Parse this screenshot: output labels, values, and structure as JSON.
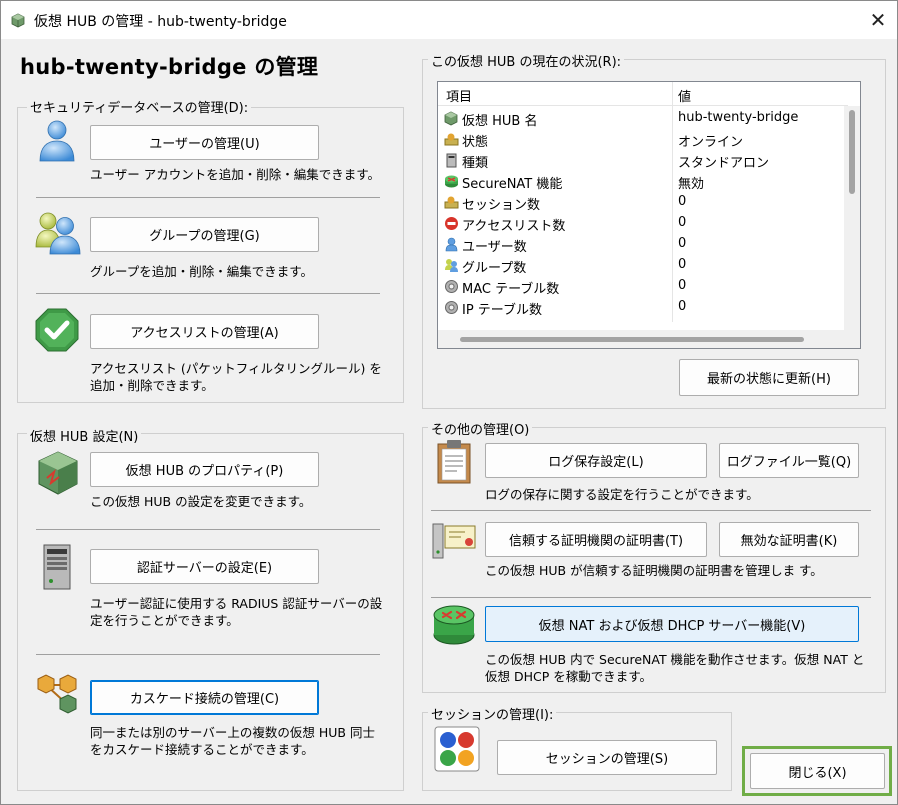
{
  "window": {
    "title": "仮想 HUB の管理 - hub-twenty-bridge",
    "close_glyph": "✕"
  },
  "heading": "hub-twenty-bridge の管理",
  "security": {
    "label": "セキュリティデータベースの管理(D):",
    "user_button": "ユーザーの管理(U)",
    "user_desc": "ユーザー アカウントを追加・削除・編集できます。",
    "group_button": "グループの管理(G)",
    "group_desc": "グループを追加・削除・編集できます。",
    "access_button": "アクセスリストの管理(A)",
    "access_desc": "アクセスリスト (パケットフィルタリングルール) を追加・削除できます。"
  },
  "hubsettings": {
    "label": "仮想 HUB 設定(N)",
    "props_button": "仮想 HUB のプロパティ(P)",
    "props_desc": "この仮想 HUB の設定を変更できます。",
    "auth_button": "認証サーバーの設定(E)",
    "auth_desc": "ユーザー認証に使用する RADIUS 認証サーバーの設定を行うことができます。",
    "cascade_button": "カスケード接続の管理(C)",
    "cascade_desc": "同一または別のサーバー上の複数の仮想 HUB 同士をカスケード接続することができます。"
  },
  "status": {
    "label": "この仮想 HUB の現在の状況(R):",
    "col_item": "項目",
    "col_value": "値",
    "rows": [
      {
        "item": "仮想 HUB 名",
        "value": "hub-twenty-bridge",
        "icon": "hub-icon"
      },
      {
        "item": "状態",
        "value": "オンライン",
        "icon": "status-icon"
      },
      {
        "item": "種類",
        "value": "スタンドアロン",
        "icon": "server-type-icon"
      },
      {
        "item": "SecureNAT 機能",
        "value": "無効",
        "icon": "securenat-icon"
      },
      {
        "item": "セッション数",
        "value": "0",
        "icon": "session-icon"
      },
      {
        "item": "アクセスリスト数",
        "value": "0",
        "icon": "access-list-icon"
      },
      {
        "item": "ユーザー数",
        "value": "0",
        "icon": "user-icon"
      },
      {
        "item": "グループ数",
        "value": "0",
        "icon": "group-icon"
      },
      {
        "item": "MAC テーブル数",
        "value": "0",
        "icon": "gear-icon"
      },
      {
        "item": "IP テーブル数",
        "value": "0",
        "icon": "gear-icon"
      }
    ],
    "refresh_button": "最新の状態に更新(H)"
  },
  "other": {
    "label": "その他の管理(O)",
    "log_button": "ログ保存設定(L)",
    "logfiles_button": "ログファイル一覧(Q)",
    "log_desc": "ログの保存に関する設定を行うことができます。",
    "cert_button": "信頼する証明機関の証明書(T)",
    "invalid_cert_button": "無効な証明書(K)",
    "cert_desc": "この仮想 HUB が信頼する証明機関の証明書を管理しま す。",
    "nat_button": "仮想 NAT および仮想 DHCP サーバー機能(V)",
    "nat_desc": "この仮想 HUB 内で SecureNAT 機能を動作させます。仮想 NAT と仮想 DHCP を稼動できます。"
  },
  "session": {
    "label": "セッションの管理(I):",
    "button": "セッションの管理(S)"
  },
  "close_button": "閉じる(X)"
}
